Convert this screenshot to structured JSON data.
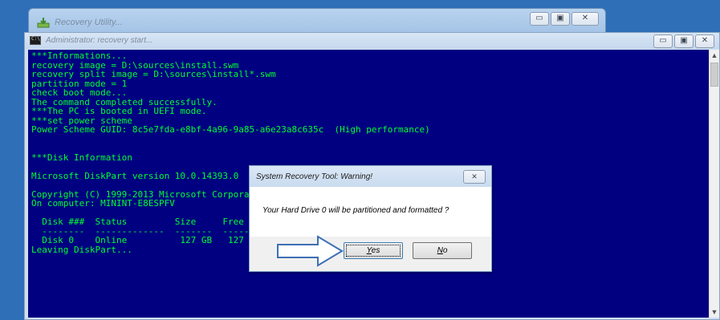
{
  "bg_window": {
    "title": "Recovery Utility..."
  },
  "console": {
    "title": "Administrator: recovery start...",
    "text_color": "#00ff30",
    "background": "#000080",
    "lines": [
      "***Informations...",
      "recovery image = D:\\sources\\install.swm",
      "recovery split image = D:\\sources\\install*.swm",
      "partition mode = 1",
      "check boot mode...",
      "The command completed successfully.",
      "***The PC is booted in UEFI mode.",
      "***set power scheme",
      "Power Scheme GUID: 8c5e7fda-e8bf-4a96-9a85-a6e23a8c635c  (High performance)",
      "",
      "",
      "***Disk Information",
      "",
      "Microsoft DiskPart version 10.0.14393.0",
      "",
      "Copyright (C) 1999-2013 Microsoft Corporation.",
      "On computer: MININT-E8ESPFV",
      "",
      "  Disk ###  Status         Size     Free     Dyn  Gpt",
      "  --------  -------------  -------  -------  ---  ---",
      "  Disk 0    Online          127 GB   127 GB",
      "Leaving DiskPart..."
    ]
  },
  "dialog": {
    "title": "System Recovery Tool: Warning!",
    "message": "Your Hard Drive 0 will be partitioned and formatted ?",
    "yes_mnemonic": "Y",
    "yes_rest": "es",
    "no_mnemonic": "N",
    "no_rest": "o"
  },
  "icons": {
    "bg_app": "recovery-app-icon",
    "console": "cmd-icon",
    "pointer": "arrow-pointer-icon"
  }
}
